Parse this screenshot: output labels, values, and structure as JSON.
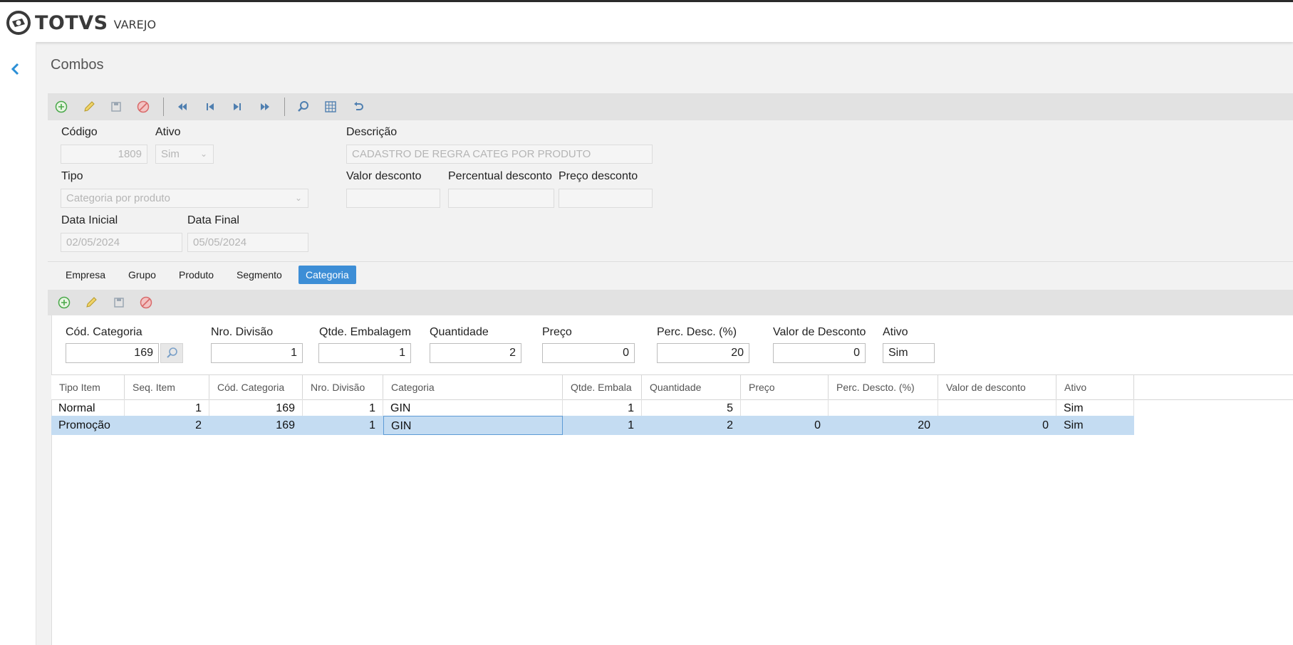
{
  "app": {
    "brand": "TOTVS",
    "module": "VAREJO"
  },
  "page": {
    "title": "Combos"
  },
  "form": {
    "codigo": {
      "label": "Código",
      "value": "1809"
    },
    "ativo": {
      "label": "Ativo",
      "value": "Sim"
    },
    "descricao": {
      "label": "Descrição",
      "value": "CADASTRO DE REGRA CATEG POR PRODUTO"
    },
    "tipo": {
      "label": "Tipo",
      "value": "Categoria por produto"
    },
    "valor_desconto": {
      "label": "Valor desconto",
      "value": ""
    },
    "percentual_desconto": {
      "label": "Percentual desconto",
      "value": ""
    },
    "preco_desconto": {
      "label": "Preço desconto",
      "value": ""
    },
    "data_inicial": {
      "label": "Data Inicial",
      "value": "02/05/2024"
    },
    "data_final": {
      "label": "Data Final",
      "value": "05/05/2024"
    }
  },
  "tabs": [
    "Empresa",
    "Grupo",
    "Produto",
    "Segmento",
    "Categoria"
  ],
  "active_tab": "Categoria",
  "detail": {
    "cod_categoria": {
      "label": "Cód. Categoria",
      "value": "169"
    },
    "nro_divisao": {
      "label": "Nro. Divisão",
      "value": "1"
    },
    "qtde_embalagem": {
      "label": "Qtde. Embalagem",
      "value": "1"
    },
    "quantidade": {
      "label": "Quantidade",
      "value": "2"
    },
    "preco": {
      "label": "Preço",
      "value": "0"
    },
    "perc_desc": {
      "label": "Perc. Desc. (%)",
      "value": "20"
    },
    "valor_de_desconto": {
      "label": "Valor de Desconto",
      "value": "0"
    },
    "ativo": {
      "label": "Ativo",
      "value": "Sim"
    }
  },
  "grid": {
    "columns": [
      "Tipo Item",
      "Seq. Item",
      "Cód. Categoria",
      "Nro. Divisão",
      "Categoria",
      "Qtde. Embala",
      "Quantidade",
      "Preço",
      "Perc. Descto. (%)",
      "Valor de desconto",
      "Ativo"
    ],
    "rows": [
      [
        "Normal",
        "1",
        "169",
        "1",
        "GIN",
        "1",
        "5",
        "",
        "",
        "",
        "Sim"
      ],
      [
        "Promoção",
        "2",
        "169",
        "1",
        "GIN",
        "1",
        "2",
        "0",
        "20",
        "0",
        "Sim"
      ]
    ],
    "selected_row": 1
  },
  "colors": {
    "accent": "#3d8ed6",
    "selected_row": "#c4dcf2",
    "toolbar": "#e2e2e2"
  },
  "icons": [
    "add-icon",
    "edit-icon",
    "save-icon",
    "cancel-icon",
    "first-record-icon",
    "previous-record-icon",
    "next-record-icon",
    "last-record-icon",
    "search-icon",
    "grid-icon",
    "undo-icon",
    "back-chevron-icon",
    "lookup-search-icon"
  ]
}
